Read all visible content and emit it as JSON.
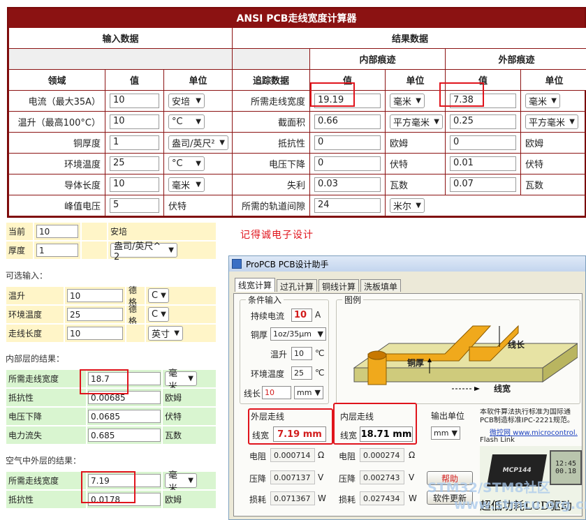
{
  "ansi": {
    "title": "ANSI PCB走线宽度计算器",
    "input_header": "输入数据",
    "result_header": "结果数据",
    "internal_header": "内部痕迹",
    "external_header": "外部痕迹",
    "col_field": "领域",
    "col_value": "值",
    "col_unit": "单位",
    "col_trace": "追踪数据",
    "inputs": [
      {
        "label": "电流（最大35A）",
        "value": "10",
        "unit": "安培",
        "unit_select": true
      },
      {
        "label": "温升（最高100°C）",
        "value": "10",
        "unit": "°C",
        "unit_select": true
      },
      {
        "label": "铜厚度",
        "value": "1",
        "unit": "盎司/英尺²",
        "unit_select": true
      },
      {
        "label": "环境温度",
        "value": "25",
        "unit": "°C",
        "unit_select": true
      },
      {
        "label": "导体长度",
        "value": "10",
        "unit": "毫米",
        "unit_select": true
      },
      {
        "label": "峰值电压",
        "value": "5",
        "unit": "伏特",
        "unit_select": false
      }
    ],
    "results": [
      {
        "label": "所需走线宽度",
        "int_value": "19.19",
        "int_unit": "毫米",
        "int_sel": true,
        "ext_value": "7.38",
        "ext_unit": "毫米",
        "ext_sel": true
      },
      {
        "label": "截面积",
        "int_value": "0.66",
        "int_unit": "平方毫米",
        "int_sel": true,
        "ext_value": "0.25",
        "ext_unit": "平方毫米",
        "ext_sel": true
      },
      {
        "label": "抵抗性",
        "int_value": "0",
        "int_unit": "欧姆",
        "int_sel": false,
        "ext_value": "0",
        "ext_unit": "欧姆",
        "ext_sel": false
      },
      {
        "label": "电压下降",
        "int_value": "0",
        "int_unit": "伏特",
        "int_sel": false,
        "ext_value": "0.01",
        "ext_unit": "伏特",
        "ext_sel": false
      },
      {
        "label": "失利",
        "int_value": "0.03",
        "int_unit": "瓦数",
        "int_sel": false,
        "ext_value": "0.07",
        "ext_unit": "瓦数",
        "ext_sel": false
      }
    ],
    "clearance": {
      "label": "所需的轨道间隙",
      "value": "24",
      "unit": "米尔"
    }
  },
  "left": {
    "current_label": "当前",
    "current_value": "10",
    "current_unit": "安培",
    "thick_label": "厚度",
    "thick_value": "1",
    "thick_unit": "盎司/英尺^ 2",
    "optional_title": "可选输入：",
    "opt": [
      {
        "label": "温升",
        "value": "10",
        "unit_a": "德格",
        "unit_b": "C"
      },
      {
        "label": "环境温度",
        "value": "25",
        "unit_a": "德格",
        "unit_b": "C"
      },
      {
        "label": "走线长度",
        "value": "10",
        "unit_a": "",
        "unit_b": "英寸"
      }
    ],
    "inner_title": "内部层的结果：",
    "inner": [
      {
        "label": "所需走线宽度",
        "value": "18.7",
        "unit": "毫米",
        "sel": true
      },
      {
        "label": "抵抗性",
        "value": "0.00685",
        "unit": "欧姆",
        "sel": false
      },
      {
        "label": "电压下降",
        "value": "0.0685",
        "unit": "伏特",
        "sel": false
      },
      {
        "label": "电力流失",
        "value": "0.685",
        "unit": "瓦数",
        "sel": false
      }
    ],
    "outer_title": "空气中外层的结果：",
    "outer": [
      {
        "label": "所需走线宽度",
        "value": "7.19",
        "unit": "毫米",
        "sel": true
      },
      {
        "label": "抵抗性",
        "value": "0.0178",
        "unit": "欧姆",
        "sel": false
      }
    ]
  },
  "note": "记得诚电子设计",
  "propcb": {
    "title": "ProPCB PCB设计助手",
    "tabs": [
      "线宽计算",
      "过孔计算",
      "铜线计算",
      "洗板填单"
    ],
    "cond_title": "条件输入",
    "current_label": "持续电流",
    "current_value": "10",
    "current_unit": "A",
    "copper_label": "铜厚",
    "copper_value": "1oz/35μm",
    "rise_label": "温升",
    "rise_value": "10",
    "rise_unit": "℃",
    "ambient_label": "环境温度",
    "ambient_value": "25",
    "ambient_unit": "℃",
    "length_label": "线长",
    "length_value": "10",
    "length_unit": "mm",
    "figure_title": "图例",
    "fig_length": "线长",
    "fig_copper": "铜厚",
    "fig_width": "线宽",
    "outer_title": "外层走线",
    "outer_width_label": "线宽",
    "outer_width": "7.19 mm",
    "inner_title": "内层走线",
    "inner_width_label": "线宽",
    "inner_width": "18.71 mm",
    "output_unit_label": "输出单位",
    "output_unit": "mm",
    "res_label": "电阻",
    "drop_label": "压降",
    "loss_label": "损耗",
    "outer_res": "0.000714",
    "outer_drop": "0.007137",
    "outer_loss": "0.071367",
    "inner_res": "0.000274",
    "inner_drop": "0.002743",
    "inner_loss": "0.027434",
    "unit_ohm": "Ω",
    "unit_v": "V",
    "unit_w": "W",
    "desc": "本软件算法执行标准为国际通\nPCB制造标准IPC-2221规范。",
    "link": "微控网 www.microcontrol.",
    "flash": "Flash Link",
    "help_button": "帮助",
    "update_button": "软件更新",
    "ad_text": "超低功耗LCD驱动",
    "chip_label": "MCP144",
    "lcd_text_1": "12:45",
    "lcd_text_2": "00.18",
    "watermark_1": "STM32/STM8社区",
    "watermark_2": "www.stmcu.org.cn"
  }
}
